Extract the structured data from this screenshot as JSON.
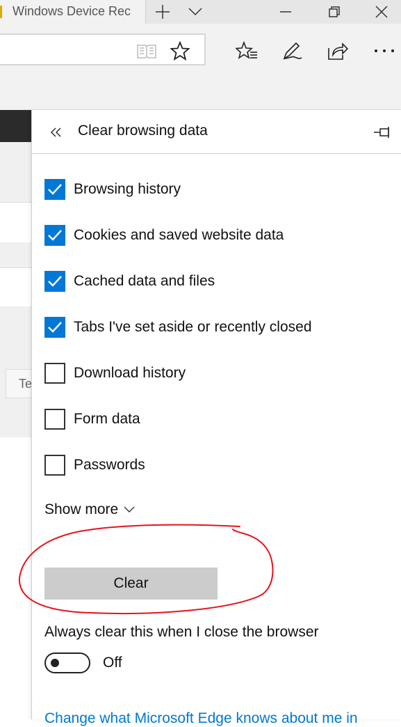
{
  "window": {
    "tab_title": "Windows Device Rec",
    "new_tab_symbol": "+",
    "tab_list_symbol": "⌵"
  },
  "toolbar": {
    "icons": [
      "reading-view-icon",
      "favorite-star-icon",
      "hub-icon",
      "web-note-icon",
      "share-icon",
      "more-icon"
    ]
  },
  "background_page": {
    "tab_fragment": "Te"
  },
  "panel": {
    "title": "Clear browsing data",
    "options": [
      {
        "label": "Browsing history",
        "checked": true
      },
      {
        "label": "Cookies and saved website data",
        "checked": true
      },
      {
        "label": "Cached data and files",
        "checked": true
      },
      {
        "label": "Tabs I've set aside or recently closed",
        "checked": true
      },
      {
        "label": "Download history",
        "checked": false
      },
      {
        "label": "Form data",
        "checked": false
      },
      {
        "label": "Passwords",
        "checked": false
      }
    ],
    "show_more": "Show more",
    "clear_button": "Clear",
    "always_clear_label": "Always clear this when I close the browser",
    "toggle_state": "Off",
    "link_text": "Change what Microsoft Edge knows about me in"
  },
  "colors": {
    "accent": "#0078d7",
    "annotation": "#e8121a",
    "clear_button_bg": "#cccccc"
  }
}
